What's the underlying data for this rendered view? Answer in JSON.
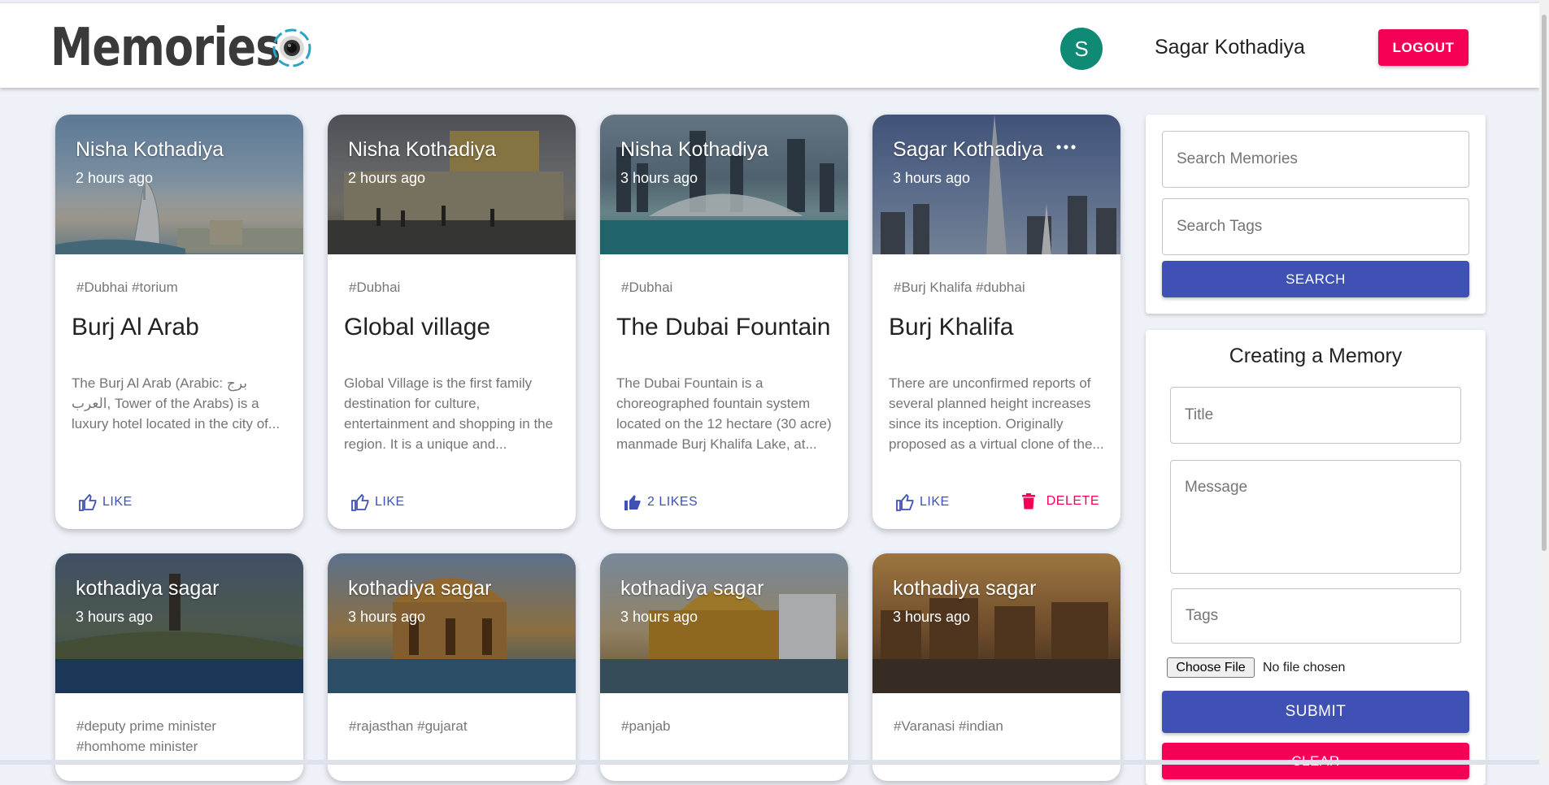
{
  "header": {
    "brand": "Memories",
    "avatar_letter": "S",
    "user_name": "Sagar Kothadiya",
    "logout_label": "LOGOUT"
  },
  "posts": [
    {
      "author": "Nisha Kothadiya",
      "time": "2 hours ago",
      "tags": "#Dubhai #torium",
      "title": "Burj Al Arab",
      "message": "The Burj Al Arab (Arabic: برج العرب, Tower of the Arabs) is a luxury hotel located in the city of...",
      "like_label": "LIKE"
    },
    {
      "author": "Nisha Kothadiya",
      "time": "2 hours ago",
      "tags": "#Dubhai",
      "title": "Global village",
      "message": "Global Village is the first family destination for culture, entertainment and shopping in the region. It is a unique and...",
      "like_label": "LIKE"
    },
    {
      "author": "Nisha Kothadiya",
      "time": "3 hours ago",
      "tags": "#Dubhai",
      "title": "The Dubai Fountain",
      "message": "The Dubai Fountain is a choreographed fountain system located on the 12 hectare (30 acre) manmade Burj Khalifa Lake, at...",
      "like_label": "2 LIKES"
    },
    {
      "author": "Sagar Kothadiya",
      "time": "3 hours ago",
      "tags": "#Burj Khalifa #dubhai",
      "title": "Burj Khalifa",
      "message": "There are unconfirmed reports of several planned height increases since its inception. Originally proposed as a virtual clone of the...",
      "like_label": "LIKE",
      "delete_label": "DELETE"
    },
    {
      "author": "kothadiya sagar",
      "time": "3 hours ago",
      "tags": "#deputy prime minister #homhome minister"
    },
    {
      "author": "kothadiya sagar",
      "time": "3 hours ago",
      "tags": "#rajasthan #gujarat"
    },
    {
      "author": "kothadiya sagar",
      "time": "3 hours ago",
      "tags": "#panjab"
    },
    {
      "author": "kothadiya sagar",
      "time": "3 hours ago",
      "tags": "#Varanasi #indian"
    }
  ],
  "search": {
    "memories_placeholder": "Search Memories",
    "tags_placeholder": "Search Tags",
    "button_label": "SEARCH"
  },
  "form": {
    "title": "Creating a Memory",
    "title_placeholder": "Title",
    "message_placeholder": "Message",
    "tags_placeholder": "Tags",
    "file_button_label": "Choose File",
    "file_status": "No file chosen",
    "submit_label": "SUBMIT",
    "clear_label": "CLEAR"
  },
  "colors": {
    "primary": "#3f51b5",
    "secondary": "#f50057",
    "avatar": "#0f8a74"
  }
}
